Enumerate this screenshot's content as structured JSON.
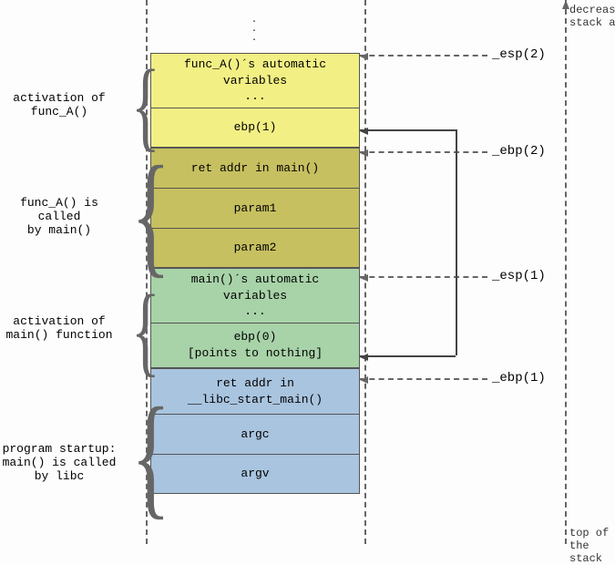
{
  "arrow_notes": {
    "top": "decreasing\nstack addresses",
    "bottom": "top of the stack"
  },
  "cells": {
    "c1": "func_A()´s automatic\nvariables\n...",
    "c2": "ebp(1)",
    "c3": "ret addr in main()",
    "c4": "param1",
    "c5": "param2",
    "c6": "main()´s automatic\nvariables\n...",
    "c7": "ebp(0)\n[points to nothing]",
    "c8": "ret addr in\n__libc_start_main()",
    "c9": "argc",
    "c10": "argv"
  },
  "left_labels": {
    "l1": "activation of\nfunc_A()",
    "l2": "func_A() is\ncalled\nby main()",
    "l3": "activation of\nmain() function",
    "l4": "program startup:\nmain() is called\nby libc"
  },
  "tags": {
    "esp2": "_esp(2)",
    "ebp2": "_ebp(2)",
    "esp1": "_esp(1)",
    "ebp1": "_ebp(1)"
  }
}
